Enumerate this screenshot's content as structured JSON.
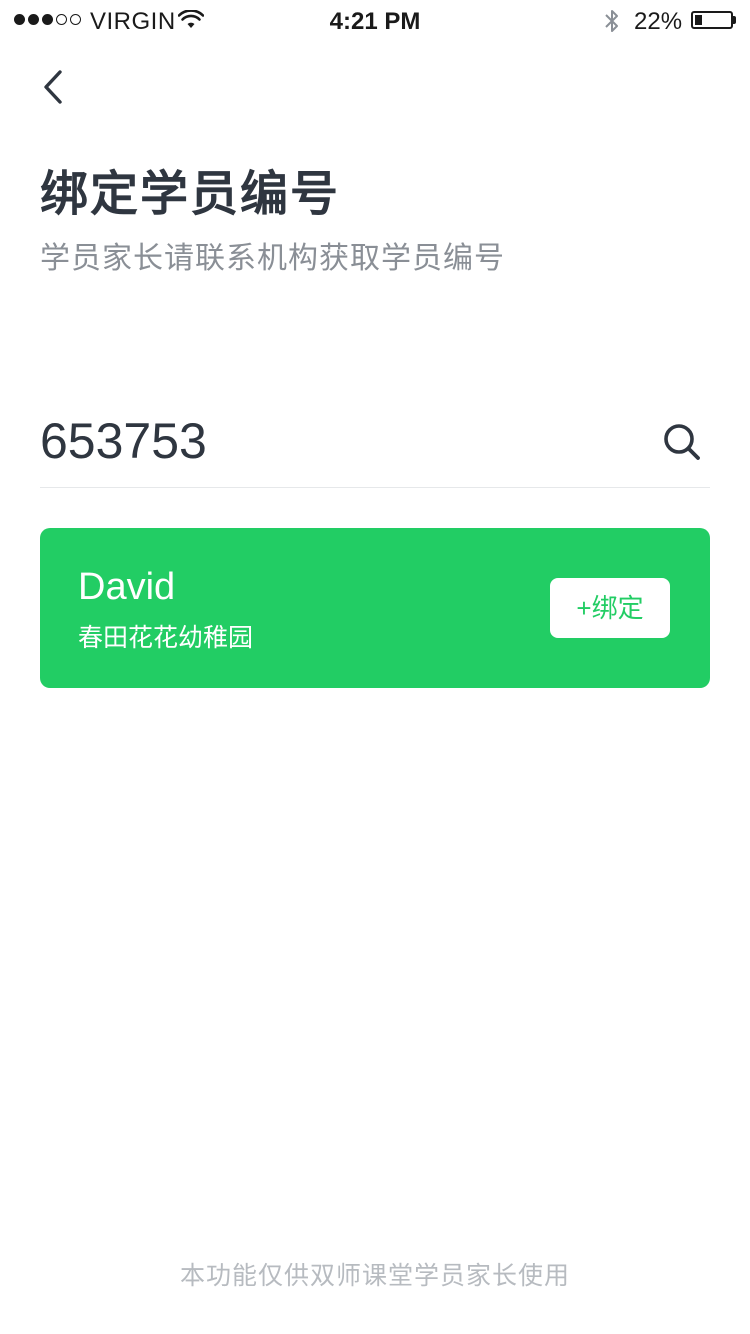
{
  "status_bar": {
    "carrier": "VIRGIN",
    "signal_bars_filled": 3,
    "signal_bars_total": 5,
    "time": "4:21 PM",
    "battery_percent": "22%",
    "battery_level": 0.22,
    "icons": [
      "wifi-icon",
      "bluetooth-icon",
      "battery-icon"
    ]
  },
  "nav": {
    "back_icon": "chevron-left-icon"
  },
  "header": {
    "title": "绑定学员编号",
    "subtitle": "学员家长请联系机构获取学员编号"
  },
  "search": {
    "value": "653753",
    "icon": "search-icon"
  },
  "result": {
    "name": "David",
    "school": "春田花花幼稚园",
    "bind_label": "+绑定"
  },
  "footer": {
    "note": "本功能仅供双师课堂学员家长使用"
  },
  "colors": {
    "accent": "#22cd64",
    "title": "#2f3640",
    "subtitle": "#8a8f96",
    "footer": "#b7bbc0",
    "divider": "#e6e8ea"
  }
}
